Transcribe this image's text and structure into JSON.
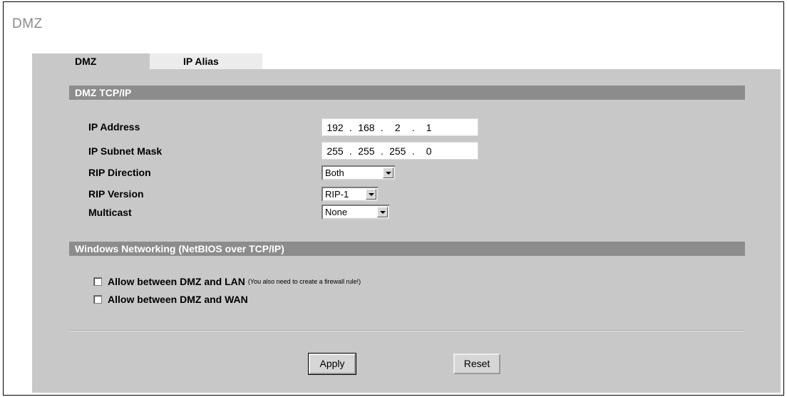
{
  "page": {
    "title": "DMZ"
  },
  "tabs": [
    {
      "label": "DMZ",
      "active": true
    },
    {
      "label": "IP Alias",
      "active": false
    }
  ],
  "sections": {
    "tcpip": "DMZ TCP/IP",
    "windows": "Windows Networking (NetBIOS over TCP/IP)"
  },
  "fields": {
    "ip_address": {
      "label": "IP Address",
      "octets": [
        "192",
        "168",
        "2",
        "1"
      ]
    },
    "subnet_mask": {
      "label": "IP Subnet Mask",
      "octets": [
        "255",
        "255",
        "255",
        "0"
      ]
    },
    "rip_direction": {
      "label": "RIP Direction",
      "value": "Both"
    },
    "rip_version": {
      "label": "RIP Version",
      "value": "RIP-1"
    },
    "multicast": {
      "label": "Multicast",
      "value": "None"
    }
  },
  "checkboxes": [
    {
      "label": "Allow between DMZ and LAN",
      "note": "(You also need to create a firewall rule!)",
      "checked": false
    },
    {
      "label": "Allow between DMZ and WAN",
      "note": "",
      "checked": false
    }
  ],
  "buttons": {
    "apply": "Apply",
    "reset": "Reset"
  },
  "colors": {
    "panel": "#c8c8c8",
    "section_header": "#8c8c8c",
    "title": "#8a8a8a"
  }
}
